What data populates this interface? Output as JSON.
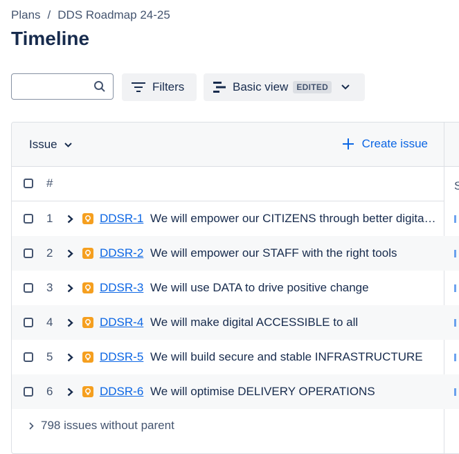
{
  "breadcrumb": {
    "parent": "Plans",
    "separator": "/",
    "current": "DDS Roadmap 24-25"
  },
  "page_title": "Timeline",
  "search": {
    "value": "",
    "placeholder": ""
  },
  "toolbar": {
    "filters_label": "Filters",
    "view_label": "Basic view",
    "view_badge": "EDITED"
  },
  "table": {
    "issue_header": "Issue",
    "create_label": "Create issue",
    "number_header": "#",
    "next_column_header": "S",
    "rows": [
      {
        "num": "1",
        "key": "DDSR-1",
        "summary": "We will empower our CITIZENS through better digital services"
      },
      {
        "num": "2",
        "key": "DDSR-2",
        "summary": "We will empower our STAFF with the right tools"
      },
      {
        "num": "3",
        "key": "DDSR-3",
        "summary": "We will use DATA to drive positive change"
      },
      {
        "num": "4",
        "key": "DDSR-4",
        "summary": "We will make digital ACCESSIBLE to all"
      },
      {
        "num": "5",
        "key": "DDSR-5",
        "summary": "We will build secure and stable INFRASTRUCTURE"
      },
      {
        "num": "6",
        "key": "DDSR-6",
        "summary": "We will optimise DELIVERY OPERATIONS"
      }
    ],
    "footer_label": "798 issues without parent"
  },
  "colors": {
    "accent": "#0c66e4",
    "epic": "#f59f1f",
    "text": "#172b4d"
  }
}
